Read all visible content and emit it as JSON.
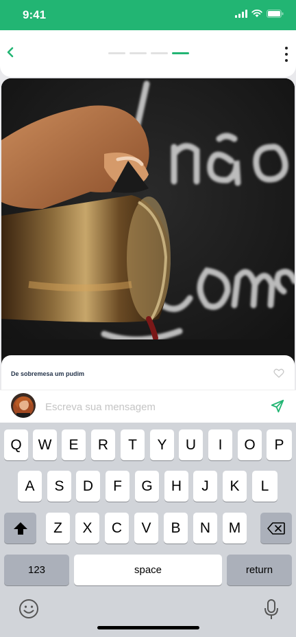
{
  "status_bar": {
    "time": "9:41"
  },
  "header": {
    "progress_steps": 4,
    "active_step": 4
  },
  "photo": {
    "description_text": "Não Come"
  },
  "post": {
    "caption": "De sobremesa um pudim"
  },
  "composer": {
    "placeholder": "Escreva sua mensagem"
  },
  "keyboard": {
    "row1": [
      "Q",
      "W",
      "E",
      "R",
      "T",
      "Y",
      "U",
      "I",
      "O",
      "P"
    ],
    "row2": [
      "A",
      "S",
      "D",
      "F",
      "G",
      "H",
      "J",
      "K",
      "L"
    ],
    "row3": [
      "Z",
      "X",
      "C",
      "V",
      "B",
      "N",
      "M"
    ],
    "numbers_label": "123",
    "space_label": "space",
    "return_label": "return"
  },
  "colors": {
    "brand": "#22b573",
    "caption": "#25344a"
  }
}
